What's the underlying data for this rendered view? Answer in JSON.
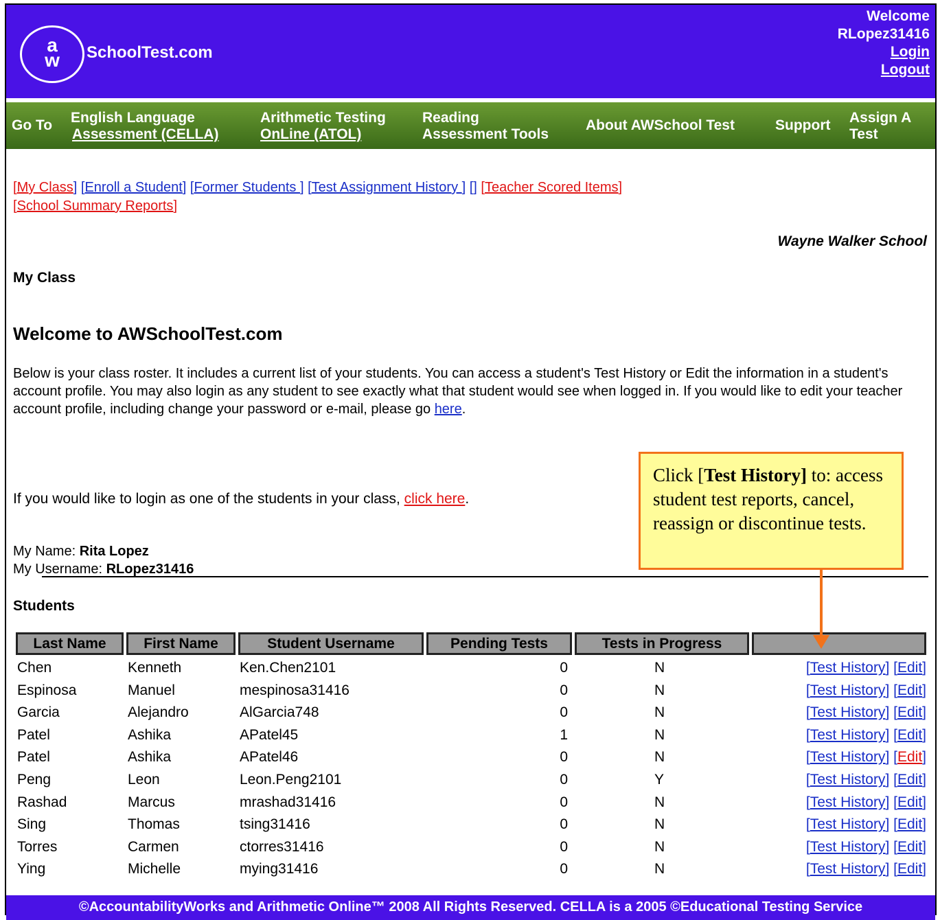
{
  "header": {
    "logo_top": "a",
    "logo_bottom": "w",
    "site_name": "SchoolTest.com",
    "welcome": "Welcome",
    "username": "RLopez31416",
    "login": "Login",
    "logout": "Logout"
  },
  "nav": {
    "goto": "Go To",
    "items": [
      {
        "line1": "English Language",
        "line2": "Assessment (CELLA)"
      },
      {
        "line1": "Arithmetic Testing",
        "line2": "OnLine (ATOL)"
      },
      {
        "line1": "Reading",
        "line2": "Assessment Tools"
      },
      {
        "line1": "About AWSchool Test"
      },
      {
        "line1": "Support"
      },
      {
        "line1": "Assign A",
        "line2": "Test"
      }
    ]
  },
  "links": {
    "my_class": "My Class",
    "enroll": "Enroll a Student",
    "former": "Former Students ",
    "history": "Test Assignment History ",
    "teacher_scored": "Teacher Scored Items",
    "school_summary": "School Summary Reports"
  },
  "school_name": "Wayne Walker School",
  "section_title": "My Class",
  "welcome_title": "Welcome to AWSchoolTest.com",
  "intro": {
    "text": "Below is your class roster. It includes a current list of your students. You can access a student's Test History or Edit the information in a student's account profile. You may also login as any student to see exactly what that student would see when logged in. If you would like to edit your teacher account profile, including change your password or e-mail, please go ",
    "link": "here",
    "end": "."
  },
  "login_line": {
    "text": "If you would like to login as one of the students in your class, ",
    "link": "click here",
    "end": "."
  },
  "profile": {
    "name_label": "My Name: ",
    "name": "Rita Lopez",
    "username_label": "My Username: ",
    "username": "RLopez31416"
  },
  "students_title": "Students",
  "callout": {
    "pre": "Click [",
    "bold": "Test History]",
    "post": " to: access student test reports, cancel, reassign or discontinue tests."
  },
  "table": {
    "headers": [
      "Last Name",
      "First Name",
      "Student Username",
      "Pending Tests",
      "Tests in Progress",
      ""
    ],
    "history_label": "Test History",
    "edit_label": "Edit",
    "rows": [
      {
        "last": "Chen",
        "first": "Kenneth",
        "user": "Ken.Chen2101",
        "pending": "0",
        "progress": "N"
      },
      {
        "last": "Espinosa",
        "first": "Manuel",
        "user": "mespinosa31416",
        "pending": "0",
        "progress": "N"
      },
      {
        "last": "Garcia",
        "first": "Alejandro",
        "user": "AlGarcia748",
        "pending": "0",
        "progress": "N"
      },
      {
        "last": "Patel",
        "first": "Ashika",
        "user": "APatel45",
        "pending": "1",
        "progress": "N"
      },
      {
        "last": "Patel",
        "first": "Ashika",
        "user": "APatel46",
        "pending": "0",
        "progress": "N"
      },
      {
        "last": "Peng",
        "first": "Leon",
        "user": "Leon.Peng2101",
        "pending": "0",
        "progress": "Y"
      },
      {
        "last": "Rashad",
        "first": "Marcus",
        "user": "mrashad31416",
        "pending": "0",
        "progress": "N"
      },
      {
        "last": "Sing",
        "first": "Thomas",
        "user": "tsing31416",
        "pending": "0",
        "progress": "N"
      },
      {
        "last": "Torres",
        "first": "Carmen",
        "user": "ctorres31416",
        "pending": "0",
        "progress": "N"
      },
      {
        "last": "Ying",
        "first": "Michelle",
        "user": "mying31416",
        "pending": "0",
        "progress": "N"
      }
    ]
  },
  "footer": "©AccountabilityWorks and Arithmetic Online™ 2008 All Rights Reserved. CELLA is a 2005 ©Educational Testing Service",
  "colors": {
    "header_bg": "#4a12e6",
    "nav_bg": "#4f8224",
    "link_blue": "#1a2fc8",
    "link_red": "#e01414",
    "callout_bg": "#fffc9a",
    "callout_border": "#f2721a",
    "table_header_bg": "#9b9b9b"
  }
}
